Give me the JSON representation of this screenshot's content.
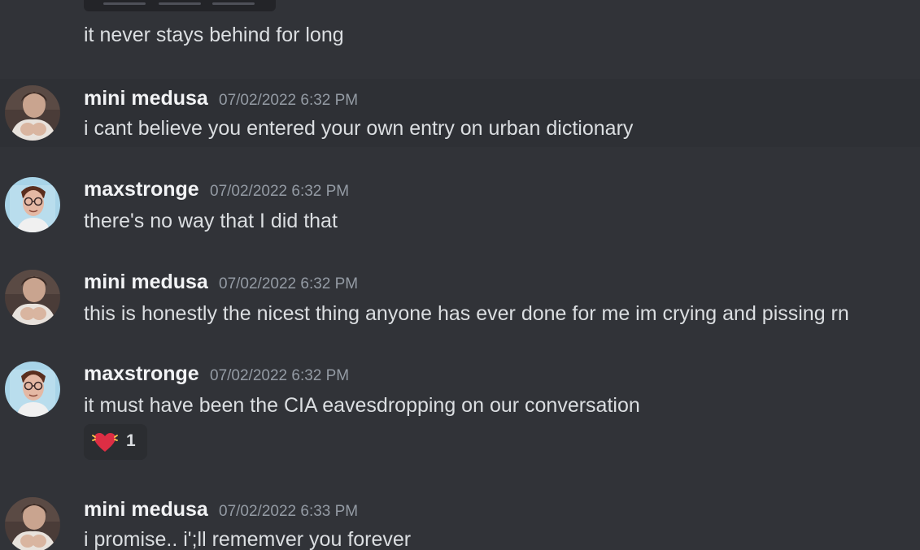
{
  "messages": [
    {
      "continuation": "it never stays behind for long"
    },
    {
      "username": "mini medusa",
      "timestamp": "07/02/2022 6:32 PM",
      "avatar": "medusa-avatar",
      "content": "i cant believe you entered your own entry on urban dictionary",
      "highlighted": true
    },
    {
      "username": "maxstronge",
      "timestamp": "07/02/2022 6:32 PM",
      "avatar": "maxstronge-avatar",
      "content": "there's no way that I did that"
    },
    {
      "username": "mini medusa",
      "timestamp": "07/02/2022 6:32 PM",
      "avatar": "medusa-avatar",
      "content": "this is honestly the nicest thing anyone has ever done for me im crying and pissing rn"
    },
    {
      "username": "maxstronge",
      "timestamp": "07/02/2022 6:32 PM",
      "avatar": "maxstronge-avatar",
      "content": "it must have been the CIA eavesdropping on our conversation",
      "reaction": {
        "emoji": "beating-heart-icon",
        "count": "1"
      }
    },
    {
      "username": "mini medusa",
      "timestamp": "07/02/2022 6:33 PM",
      "avatar": "medusa-avatar",
      "content": "i promise.. i';ll rememver you forever"
    }
  ],
  "colors": {
    "background": "#313338",
    "highlight": "#2e3035",
    "username": "#f2f3f5",
    "text": "#dbdee1",
    "timestamp": "#949ba4",
    "reaction_bg": "#2b2d31"
  }
}
